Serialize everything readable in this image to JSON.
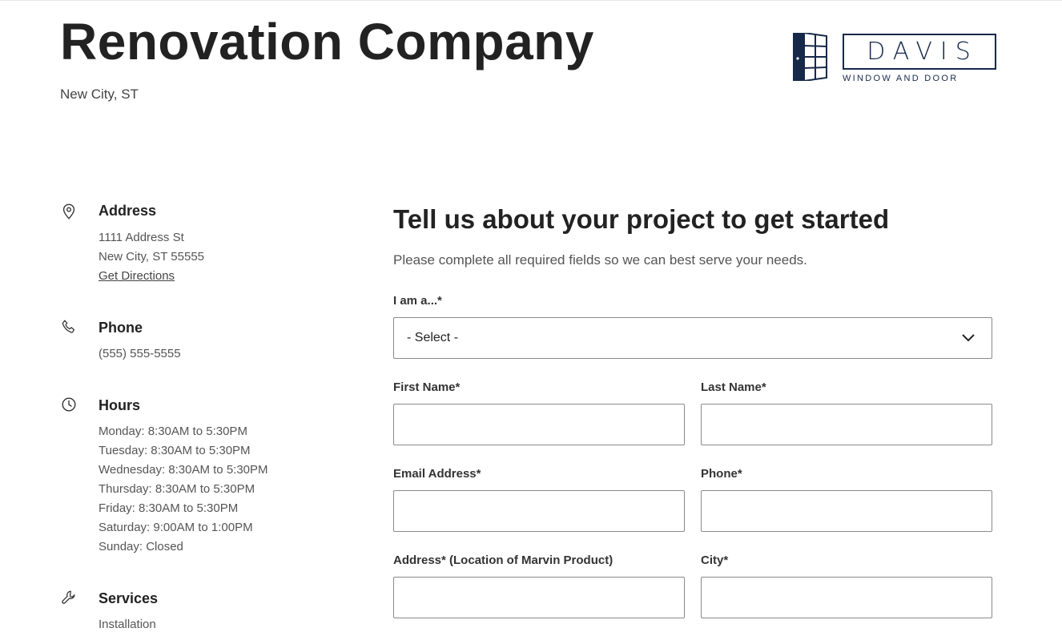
{
  "header": {
    "title": "Renovation Company",
    "location": "New City, ST"
  },
  "logo": {
    "name": "DAVIS",
    "tagline": "WINDOW AND DOOR",
    "color": "#16294a"
  },
  "sidebar": {
    "address": {
      "icon": "map-pin-icon",
      "heading": "Address",
      "line1": "1111 Address St",
      "line2": "New City, ST 55555",
      "directions_link": "Get Directions"
    },
    "phone": {
      "icon": "phone-icon",
      "heading": "Phone",
      "number": "(555) 555-5555"
    },
    "hours": {
      "icon": "clock-icon",
      "heading": "Hours",
      "days": [
        "Monday: 8:30AM to 5:30PM",
        "Tuesday: 8:30AM to 5:30PM",
        "Wednesday: 8:30AM to 5:30PM",
        "Thursday: 8:30AM to 5:30PM",
        "Friday: 8:30AM to 5:30PM",
        "Saturday: 9:00AM to 1:00PM",
        "Sunday: Closed"
      ]
    },
    "services": {
      "icon": "wrench-icon",
      "heading": "Services",
      "items": [
        "Installation"
      ]
    }
  },
  "form": {
    "title": "Tell us about your project to get started",
    "subtitle": "Please complete all required fields so we can best serve your needs.",
    "role": {
      "label": "I am a...*",
      "value": "- Select -"
    },
    "first_name": {
      "label": "First Name*",
      "value": ""
    },
    "last_name": {
      "label": "Last Name*",
      "value": ""
    },
    "email": {
      "label": "Email Address*",
      "value": ""
    },
    "phone": {
      "label": "Phone*",
      "value": ""
    },
    "address": {
      "label": "Address* (Location of Marvin Product)",
      "value": ""
    },
    "city": {
      "label": "City*",
      "value": ""
    }
  }
}
